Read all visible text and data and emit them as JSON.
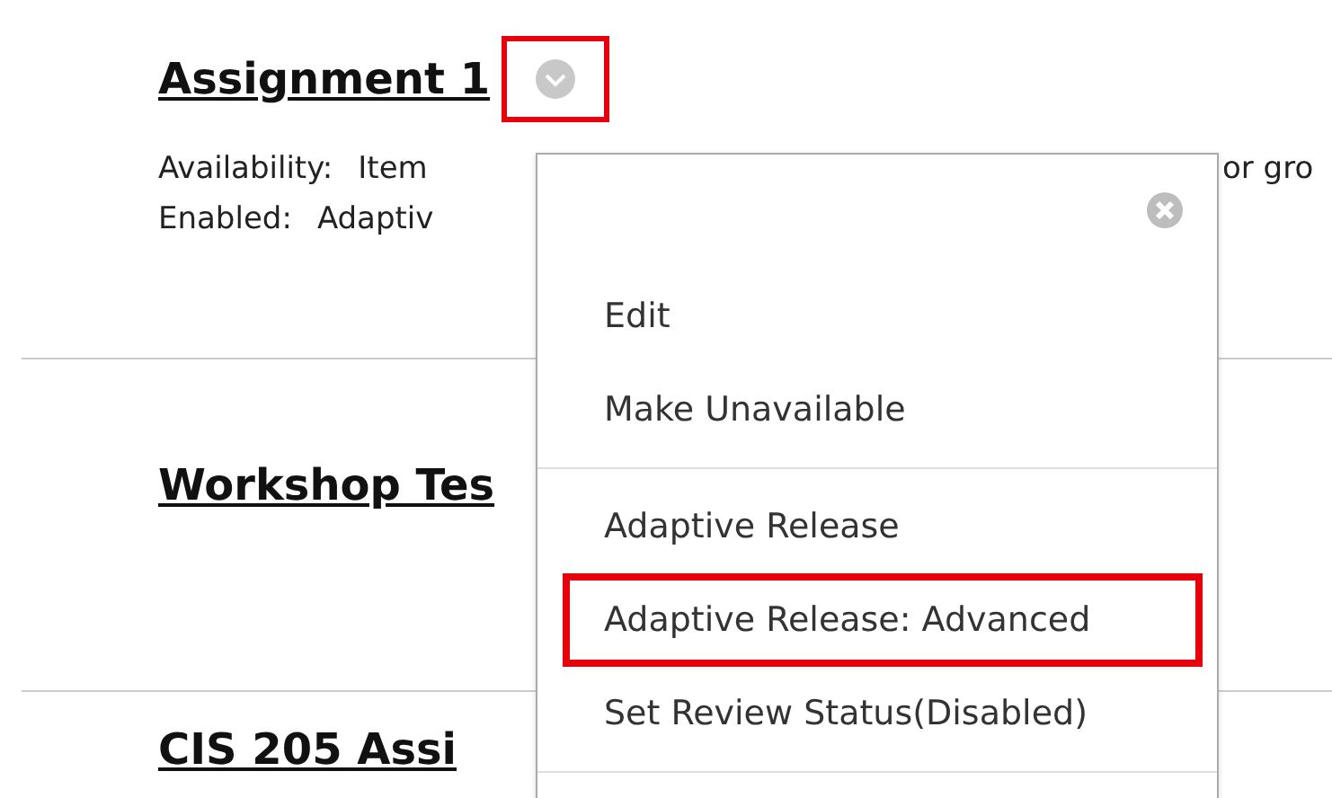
{
  "items": [
    {
      "title": "Assignment 1",
      "menu_button": {
        "highlighted": true
      },
      "details": [
        {
          "label": "Availability:",
          "value": "Item",
          "trailing": "or gro"
        },
        {
          "label": "Enabled:",
          "value": "Adaptiv"
        }
      ]
    },
    {
      "title": "Workshop Tes"
    },
    {
      "title": "CIS 205 Assi"
    }
  ],
  "context_menu": {
    "groups": [
      [
        {
          "label": "Edit",
          "highlighted": false
        },
        {
          "label": "Make Unavailable",
          "highlighted": false
        }
      ],
      [
        {
          "label": "Adaptive Release",
          "highlighted": false
        },
        {
          "label": "Adaptive Release: Advanced",
          "highlighted": true
        },
        {
          "label": "Set Review Status(Disabled)",
          "highlighted": false
        }
      ]
    ]
  }
}
